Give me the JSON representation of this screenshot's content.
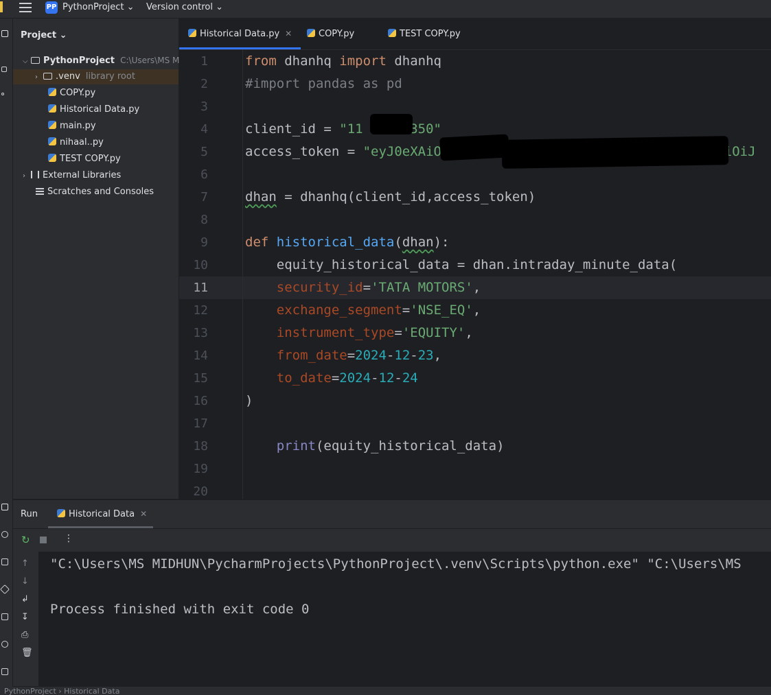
{
  "header": {
    "project_badge": "PP",
    "project_name": "PythonProject ⌄",
    "version_control": "Version control ⌄"
  },
  "project_panel": {
    "title": "Project ⌄",
    "root": {
      "name": "PythonProject",
      "path": "C:\\Users\\MS M"
    },
    "venv": {
      "name": ".venv",
      "hint": "library root"
    },
    "files": [
      "COPY.py",
      "Historical Data.py",
      "main.py",
      "nihaal..py",
      "TEST COPY.py"
    ],
    "external_libraries": "External Libraries",
    "scratches": "Scratches and Consoles"
  },
  "tabs": [
    {
      "label": "Historical Data.py",
      "active": true
    },
    {
      "label": "COPY.py",
      "active": false
    },
    {
      "label": "TEST COPY.py",
      "active": false
    }
  ],
  "editor": {
    "current_line": 11,
    "line_numbers": [
      "1",
      "2",
      "3",
      "4",
      "5",
      "6",
      "7",
      "8",
      "9",
      "10",
      "11",
      "12",
      "13",
      "14",
      "15",
      "16",
      "17",
      "18",
      "19",
      "20"
    ],
    "code": {
      "l1_from": "from",
      "l1_mod": " dhanhq ",
      "l1_import": "import",
      "l1_name": " dhanhq",
      "l2": "#import pandas as pd",
      "l4_var": "client_id = ",
      "l4_str": "\"11     2350\"",
      "l5_var": "access_token = ",
      "l5_str": "\"eyJ0eXAiOiJKV1QiLCJhb                 eyJpc3MiOiJ",
      "l7_var": "dhan",
      "l7_rest": " = dhanhq(client_id,access_token)",
      "l9_def": "def",
      "l9_fn": "historical_data",
      "l9_open": "(",
      "l9_param": "dhan",
      "l9_close": "):",
      "l10": "    equity_historical_data = dhan.intraday_minute_data(",
      "l11_kw": "security_id",
      "l11_val": "'TATA MOTORS'",
      "l12_kw": "exchange_segment",
      "l12_val": "'NSE_EQ'",
      "l13_kw": "instrument_type",
      "l13_val": "'EQUITY'",
      "l14_kw": "from_date",
      "l14_n1": "2024",
      "l14_n2": "12",
      "l14_n3": "23",
      "l15_kw": "to_date",
      "l15_n1": "2024",
      "l15_n2": "12",
      "l15_n3": "24",
      "l16": ")",
      "l18_fn": "print",
      "l18_rest": "(equity_historical_data)"
    }
  },
  "run_panel": {
    "title": "Run",
    "tab_label": "Historical Data",
    "console": [
      "\"C:\\Users\\MS MIDHUN\\PycharmProjects\\PythonProject\\.venv\\Scripts\\python.exe\" \"C:\\Users\\MS",
      "",
      "Process finished with exit code 0"
    ]
  },
  "status_bar": {
    "breadcrumb": "PythonProject  ›  Historical Data"
  }
}
